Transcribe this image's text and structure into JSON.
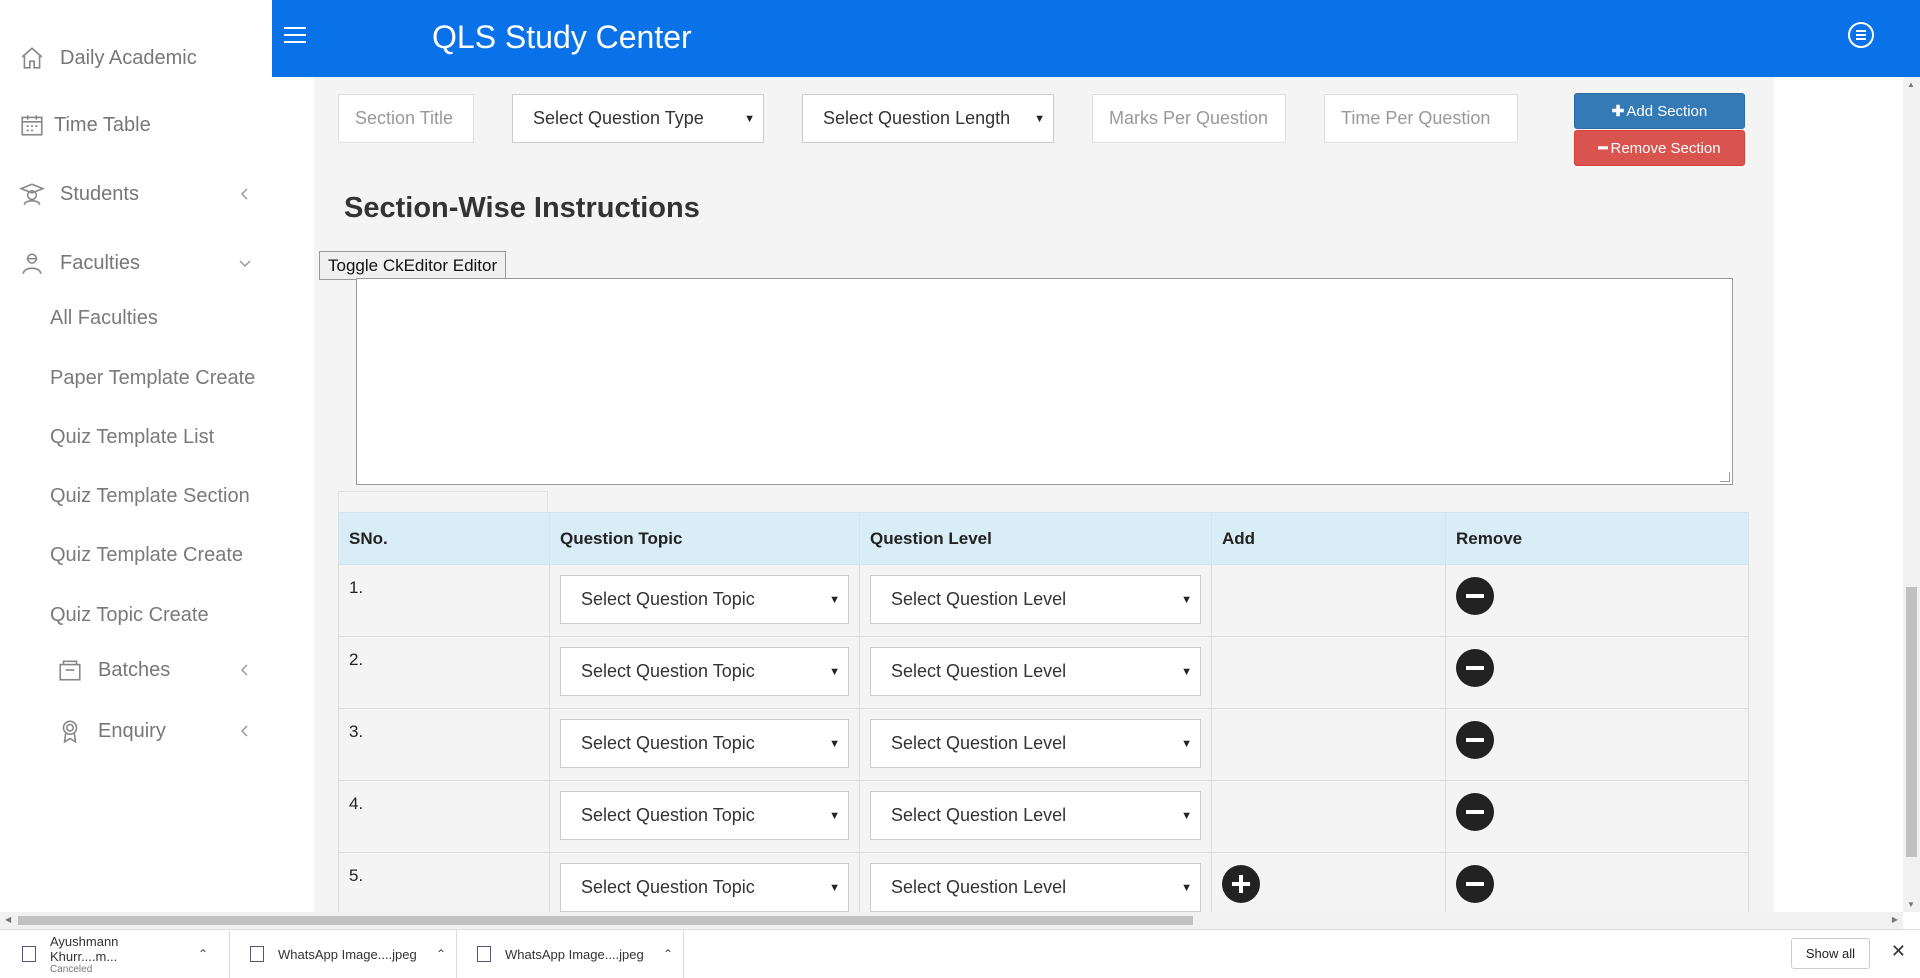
{
  "header": {
    "title": "QLS Study Center",
    "color": "#0a72e8"
  },
  "sidebar": {
    "items": [
      {
        "label": "Daily Academic",
        "icon": "home-icon"
      },
      {
        "label": "Time Table",
        "icon": "calendar-icon"
      },
      {
        "label": "Students",
        "icon": "graduate-icon"
      },
      {
        "label": "Faculties",
        "icon": "teacher-icon"
      }
    ],
    "faculty_sub": [
      {
        "label": "All Faculties"
      },
      {
        "label": "Paper Template Create"
      },
      {
        "label": "Quiz Template List"
      },
      {
        "label": "Quiz Template Section"
      },
      {
        "label": "Quiz Template Create"
      },
      {
        "label": "Quiz Topic Create"
      }
    ],
    "sub_groups": [
      {
        "label": "Batches",
        "icon": "folder-icon"
      },
      {
        "label": "Enquiry",
        "icon": "badge-icon"
      }
    ]
  },
  "form": {
    "section_title_placeholder": "Section Title",
    "question_type": "Select Question Type",
    "question_length": "Select Question Length",
    "marks_placeholder": "Marks Per Question",
    "time_placeholder": "Time Per Question",
    "add_section": "Add Section",
    "remove_section": "Remove Section",
    "add_color": "#337ab7",
    "remove_color": "#d9534f"
  },
  "instructions": {
    "heading": "Section-Wise Instructions",
    "toggle_label": "Toggle CkEditor Editor"
  },
  "table": {
    "headers": [
      "SNo.",
      "Question Topic",
      "Question Level",
      "Add",
      "Remove"
    ],
    "rows": [
      {
        "sno": "1.",
        "topic": "Select Question Topic",
        "level": "Select Question Level",
        "has_add": false
      },
      {
        "sno": "2.",
        "topic": "Select Question Topic",
        "level": "Select Question Level",
        "has_add": false
      },
      {
        "sno": "3.",
        "topic": "Select Question Topic",
        "level": "Select Question Level",
        "has_add": false
      },
      {
        "sno": "4.",
        "topic": "Select Question Topic",
        "level": "Select Question Level",
        "has_add": false
      },
      {
        "sno": "5.",
        "topic": "Select Question Topic",
        "level": "Select Question Level",
        "has_add": true
      }
    ]
  },
  "downloads": {
    "items": [
      {
        "name": "Ayushmann Khurr....m...",
        "status": "Canceled"
      },
      {
        "name": "WhatsApp Image....jpeg",
        "status": ""
      },
      {
        "name": "WhatsApp Image....jpeg",
        "status": ""
      }
    ],
    "show_all": "Show all"
  }
}
